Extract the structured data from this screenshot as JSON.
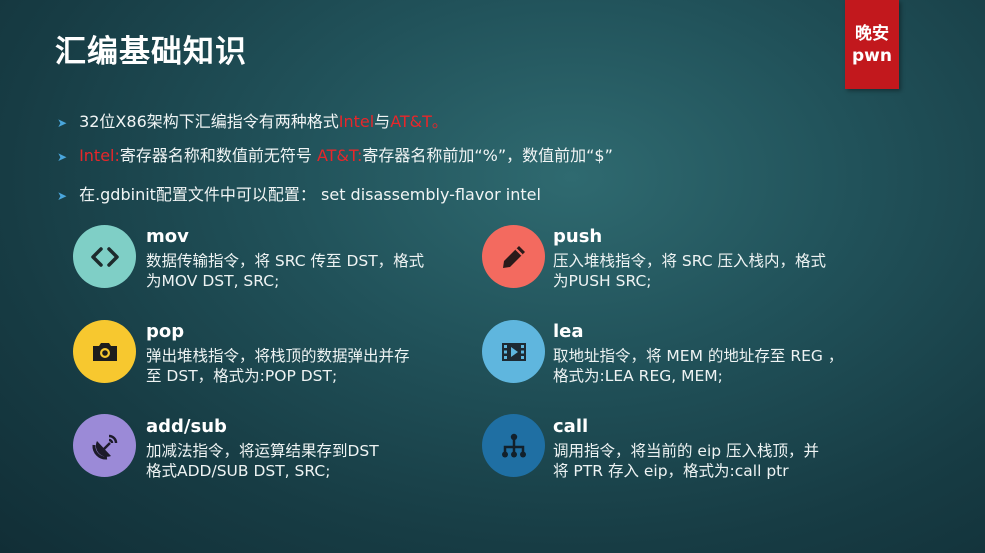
{
  "slide": {
    "title": "汇编基础知识",
    "badge": {
      "line1": "晚安",
      "line2": "pwn"
    },
    "bullets": [
      {
        "pre": "32位X86架构下汇编指令有两种格式",
        "hl1": "Intel",
        "mid": "与",
        "hl2": "AT&T。",
        "post": ""
      },
      {
        "pre": "",
        "hl1": "Intel:",
        "mid": "寄存器名称和数值前无符号 ",
        "hl2": "AT&T:",
        "post": "寄存器名称前加“%”，数值前加“$”"
      },
      {
        "pre": "在.gdbinit配置文件中可以配置： set disassembly-flavor intel",
        "hl1": "",
        "mid": "",
        "hl2": "",
        "post": ""
      }
    ],
    "cards": [
      {
        "name": "mov",
        "line1": "数据传输指令，将 SRC 传至 DST，格式",
        "line2": "为MOV DST, SRC;",
        "icon": "code-brackets-icon",
        "color": "#7fcfc6"
      },
      {
        "name": "push",
        "line1": "压入堆栈指令，将 SRC 压入栈内，格式",
        "line2": "为PUSH SRC;",
        "icon": "pencil-icon",
        "color": "#f36a5f"
      },
      {
        "name": "pop",
        "line1": "弹出堆栈指令，将栈顶的数据弹出并存",
        "line2": "至 DST，格式为:POP DST;",
        "icon": "camera-icon",
        "color": "#f7c82f"
      },
      {
        "name": "lea",
        "line1": "取地址指令，将 MEM 的地址存至 REG ，",
        "line2": "格式为:LEA REG, MEM;",
        "icon": "film-play-icon",
        "color": "#5fb6de"
      },
      {
        "name": "add/sub",
        "line1": "加减法指令，将运算结果存到DST",
        "line2": "格式ADD/SUB DST, SRC;",
        "icon": "satellite-dish-icon",
        "color": "#9b8ad7"
      },
      {
        "name": "call",
        "line1": "调用指令，将当前的 eip 压入栈顶，并",
        "line2": "将 PTR 存入 eip，格式为:call ptr",
        "icon": "hierarchy-icon",
        "color": "#1f6fa3"
      }
    ]
  }
}
